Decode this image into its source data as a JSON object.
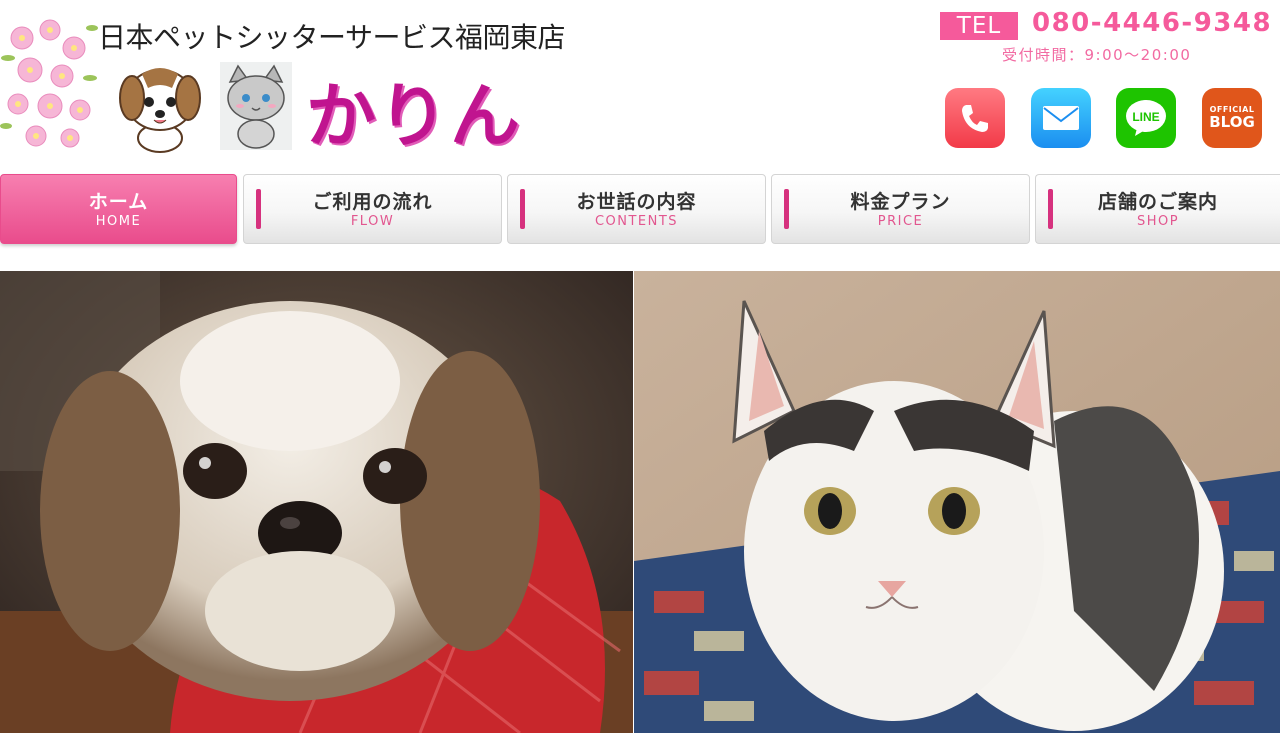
{
  "header": {
    "site_name": "日本ペットシッターサービス福岡東店",
    "brand_name": "かりん",
    "tel_label": "TEL",
    "tel_number": "080-4446-9348",
    "hours": "受付時間：9:00～20:00"
  },
  "social_icons": [
    {
      "icon": "phone-icon",
      "color": "#f23a48"
    },
    {
      "icon": "mail-icon",
      "color": "#1b8ef0"
    },
    {
      "icon": "line-icon",
      "label": "LINE",
      "color": "#1ec400"
    },
    {
      "icon": "blog-icon",
      "label_top": "OFFICIAL",
      "label": "BLOG",
      "color": "#e0561b"
    }
  ],
  "nav": [
    {
      "label": "ホーム",
      "sub": "HOME",
      "active": true
    },
    {
      "label": "ご利用の流れ",
      "sub": "FLOW",
      "active": false
    },
    {
      "label": "お世話の内容",
      "sub": "CONTENTS",
      "active": false
    },
    {
      "label": "料金プラン",
      "sub": "PRICE",
      "active": false
    },
    {
      "label": "店舗のご案内",
      "sub": "SHOP",
      "active": false
    }
  ],
  "colors": {
    "accent": "#f55a9b",
    "brand": "#c0148f",
    "nav_active": "#e94c8c"
  }
}
